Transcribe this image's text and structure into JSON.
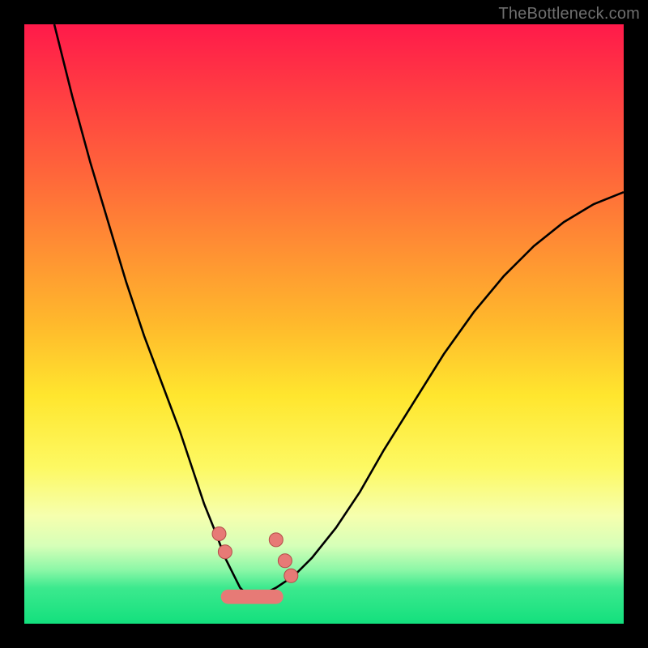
{
  "watermark": {
    "text": "TheBottleneck.com"
  },
  "colors": {
    "black": "#000000",
    "curve": "#000000",
    "marker_fill": "#e77a76",
    "marker_stroke": "#b24c48",
    "grad_top": "#ff1a4a",
    "grad_25": "#ff663a",
    "grad_50": "#ffb92c",
    "grad_62": "#ffe62e",
    "grad_74": "#fdf963",
    "grad_82": "#f6ffae",
    "grad_87": "#d6ffb8",
    "grad_91": "#8cf7a7",
    "grad_94": "#3ce98e",
    "grad_bottom": "#13e07d"
  },
  "chart_data": {
    "type": "line",
    "title": "",
    "xlabel": "",
    "ylabel": "",
    "xlim": [
      0,
      100
    ],
    "ylim": [
      0,
      100
    ],
    "series": [
      {
        "name": "left-curve",
        "x": [
          5,
          8,
          11,
          14,
          17,
          20,
          23,
          26,
          28,
          30,
          32,
          33.5,
          35,
          36,
          37,
          38
        ],
        "y": [
          100,
          88,
          77,
          67,
          57,
          48,
          40,
          32,
          26,
          20,
          15,
          11,
          8,
          6,
          5,
          5
        ]
      },
      {
        "name": "right-curve",
        "x": [
          38,
          40,
          42,
          45,
          48,
          52,
          56,
          60,
          65,
          70,
          75,
          80,
          85,
          90,
          95,
          100
        ],
        "y": [
          5,
          5,
          6,
          8,
          11,
          16,
          22,
          29,
          37,
          45,
          52,
          58,
          63,
          67,
          70,
          72
        ]
      }
    ],
    "markers": [
      {
        "name": "left-dot-1",
        "x": 32.5,
        "y": 15
      },
      {
        "name": "left-dot-2",
        "x": 33.5,
        "y": 12
      },
      {
        "name": "right-dot-1",
        "x": 42.0,
        "y": 14
      },
      {
        "name": "right-dot-2",
        "x": 43.5,
        "y": 10.5
      },
      {
        "name": "right-dot-3",
        "x": 44.5,
        "y": 8
      }
    ],
    "valley_bar": {
      "x_start": 34,
      "x_end": 42,
      "y": 4.5,
      "thickness": 2.4
    }
  }
}
